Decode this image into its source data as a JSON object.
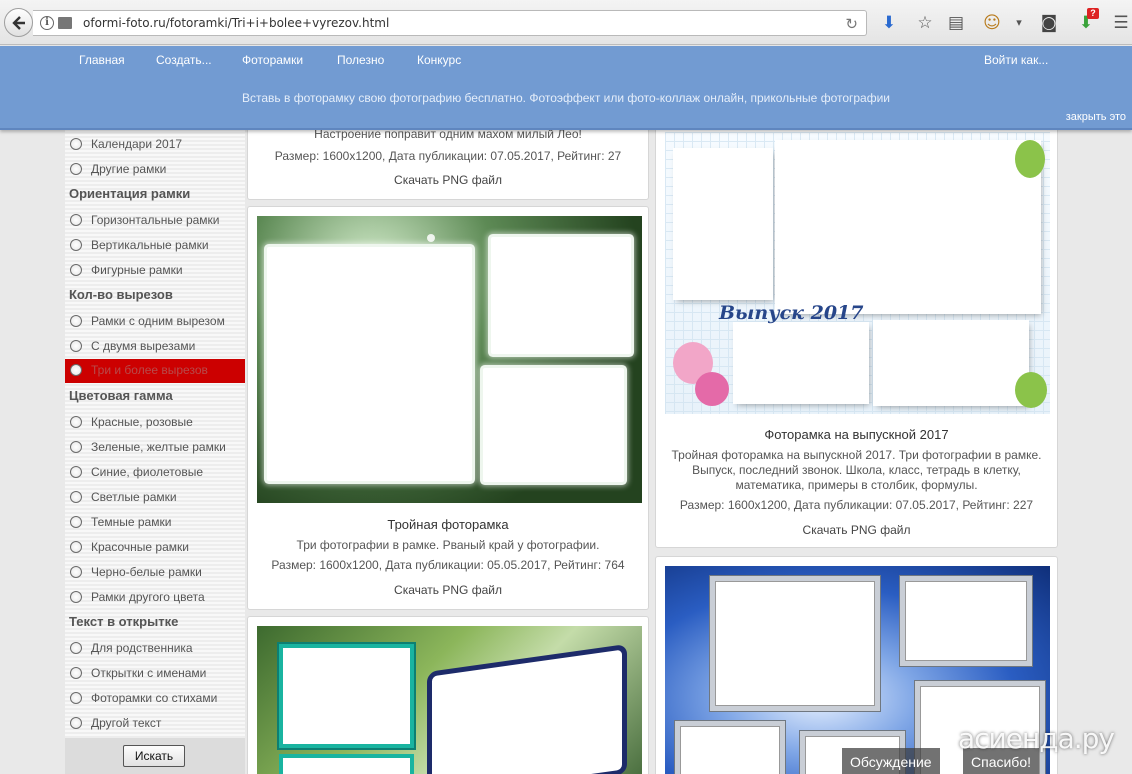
{
  "browser": {
    "url": "oformi-foto.ru/fotoramki/Tri+i+bolee+vyrezov.html",
    "badge": "?"
  },
  "nav": {
    "items": [
      "Главная",
      "Создать...",
      "Фоторамки",
      "Полезно",
      "Конкурс"
    ],
    "login": "Войти как...",
    "tagline": "Вставь в фоторамку свою фотографию бесплатно. Фотоэффект или фото-коллаж онлайн, прикольные фотографии",
    "close": "закрыть это"
  },
  "sidebar": {
    "top_items": [
      "Календари 2017",
      "Другие рамки"
    ],
    "groups": [
      {
        "heading": "Ориентация рамки",
        "items": [
          "Горизонтальные рамки",
          "Вертикальные рамки",
          "Фигурные рамки"
        ]
      },
      {
        "heading": "Кол-во вырезов",
        "items": [
          "Рамки с одним вырезом",
          "С двумя вырезами",
          "Три и более вырезов"
        ]
      },
      {
        "heading": "Цветовая гамма",
        "items": [
          "Красные, розовые",
          "Зеленые, желтые рамки",
          "Синие, фиолетовые",
          "Светлые рамки",
          "Темные рамки",
          "Красочные рамки",
          "Черно-белые рамки",
          "Рамки другого цвета"
        ]
      },
      {
        "heading": "Текст в открытке",
        "items": [
          "Для родственника",
          "Открытки с именами",
          "Фоторамки со стихами",
          "Другой текст"
        ]
      }
    ],
    "active_item": "Три и более вырезов",
    "search_button": "Искать"
  },
  "cards": {
    "prev": {
      "desc_tail": "Настроение поправит одним махом милый Лео!",
      "meta": "Размер: 1600x1200, Дата публикации: 07.05.2017, Рейтинг: 27",
      "download": "Скачать PNG файл"
    },
    "triple": {
      "title": "Тройная фоторамка",
      "desc": "Три фотографии в рамке. Рваный край у фотографии.",
      "meta": "Размер: 1600x1200, Дата публикации: 05.05.2017, Рейтинг: 764",
      "download": "Скачать PNG файл"
    },
    "grad": {
      "image_text": "Выпуск 2017",
      "title": "Фоторамка на выпускной 2017",
      "desc": "Тройная фоторамка на выпускной 2017. Три фотографии в рамке. Выпуск, последний звонок. Школа, класс, тетрадь в клетку, математика, примеры в столбик, формулы.",
      "meta": "Размер: 1600x1200, Дата публикации: 07.05.2017, Рейтинг: 227",
      "download": "Скачать PNG файл"
    }
  },
  "overlay": {
    "discuss": "Обсуждение",
    "thanks": "Спасибо!",
    "watermark": "асиенда.ру"
  }
}
